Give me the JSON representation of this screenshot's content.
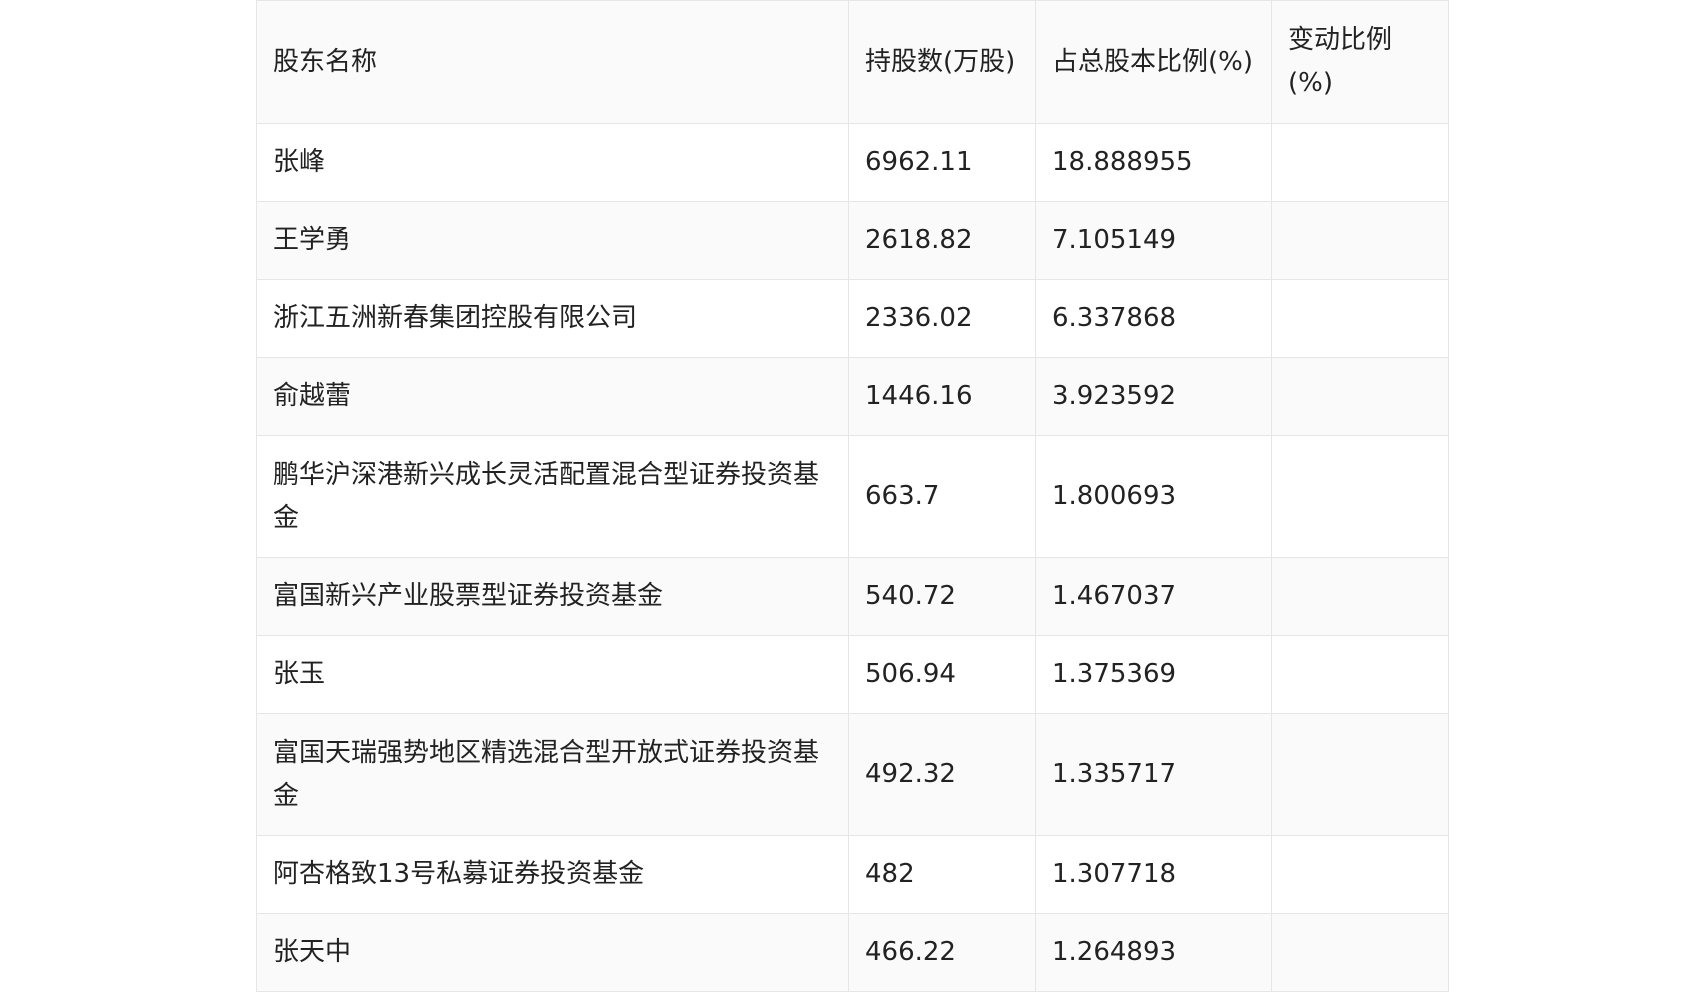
{
  "table": {
    "headers": [
      "股东名称",
      "持股数(万股)",
      "占总股本比例(%)",
      "变动比例(%)"
    ],
    "rows": [
      {
        "name": "张峰",
        "shares": "6962.11",
        "ratio": "18.888955",
        "change": ""
      },
      {
        "name": "王学勇",
        "shares": "2618.82",
        "ratio": "7.105149",
        "change": ""
      },
      {
        "name": "浙江五洲新春集团控股有限公司",
        "shares": "2336.02",
        "ratio": "6.337868",
        "change": ""
      },
      {
        "name": "俞越蕾",
        "shares": "1446.16",
        "ratio": "3.923592",
        "change": ""
      },
      {
        "name": "鹏华沪深港新兴成长灵活配置混合型证券投资基金",
        "shares": "663.7",
        "ratio": "1.800693",
        "change": ""
      },
      {
        "name": "富国新兴产业股票型证券投资基金",
        "shares": "540.72",
        "ratio": "1.467037",
        "change": ""
      },
      {
        "name": "张玉",
        "shares": "506.94",
        "ratio": "1.375369",
        "change": ""
      },
      {
        "name": "富国天瑞强势地区精选混合型开放式证券投资基金",
        "shares": "492.32",
        "ratio": "1.335717",
        "change": ""
      },
      {
        "name": "阿杏格致13号私募证券投资基金",
        "shares": "482",
        "ratio": "1.307718",
        "change": ""
      },
      {
        "name": "张天中",
        "shares": "466.22",
        "ratio": "1.264893",
        "change": ""
      }
    ]
  }
}
